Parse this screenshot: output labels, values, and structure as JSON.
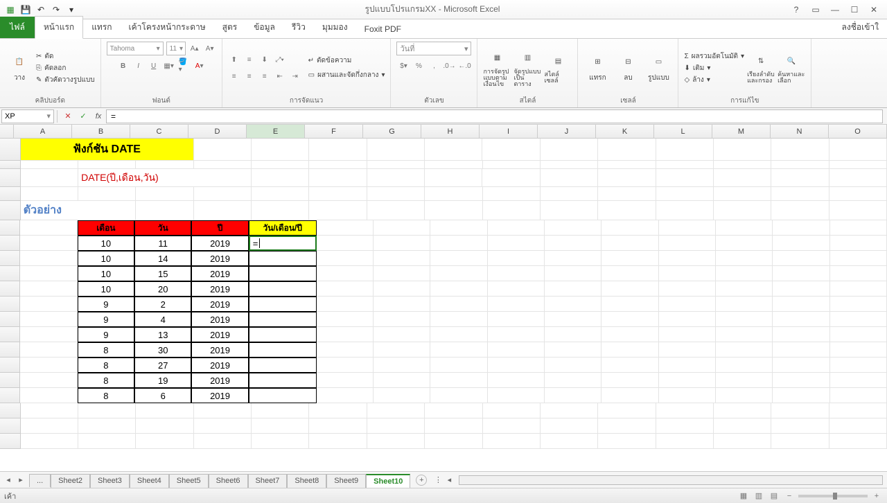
{
  "titlebar": {
    "title": "รูปแบบโปรแกรมXX - Microsoft Excel"
  },
  "tabs": {
    "file": "ไฟล์",
    "items": [
      "หน้าแรก",
      "แทรก",
      "เค้าโครงหน้ากระดาษ",
      "สูตร",
      "ข้อมูล",
      "รีวิว",
      "มุมมอง",
      "Foxit PDF"
    ],
    "active": 0,
    "signin": "ลงชื่อเข้าใ"
  },
  "ribbon": {
    "clipboard": {
      "label": "คลิปบอร์ด",
      "paste": "วาง",
      "cut": "ตัด",
      "copy": "คัดลอก",
      "fmtpainter": "ตัวคัดวางรูปแบบ"
    },
    "font": {
      "label": "ฟอนต์",
      "name": "Tahoma",
      "size": "11"
    },
    "alignment": {
      "label": "การจัดแนว",
      "wrap": "ตัดข้อความ",
      "merge": "ผสานและจัดกึ่งกลาง"
    },
    "number": {
      "label": "ตัวเลข",
      "format": "วันที่"
    },
    "styles": {
      "label": "สไตล์",
      "condfmt": "การจัดรูปแบบตามเงื่อนไข",
      "tblfmt": "จัดรูปแบบเป็นตาราง",
      "cellstyle": "สไตล์เซลล์"
    },
    "cells": {
      "label": "เซลล์",
      "insert": "แทรก",
      "delete": "ลบ",
      "format": "รูปแบบ"
    },
    "editing": {
      "label": "การแก้ไข",
      "autosum": "ผลรวมอัตโนมัติ",
      "fill": "เติม",
      "clear": "ล้าง",
      "sort": "เรียงลำดับและกรอง",
      "find": "ค้นหาและเลือก"
    }
  },
  "formulabar": {
    "namebox": "XP",
    "formula": "="
  },
  "columns": [
    "A",
    "B",
    "C",
    "D",
    "E",
    "F",
    "G",
    "H",
    "I",
    "J",
    "K",
    "L",
    "M",
    "N",
    "O"
  ],
  "activeCol": 4,
  "content": {
    "title": "ฟังก์ชัน DATE",
    "syntax": "DATE(ปี,เดือน,วัน)",
    "example": "ตัวอย่าง",
    "headers": {
      "month": "เดือน",
      "day": "วัน",
      "year": "ปี",
      "dmy": "วัน/เดือน/ปี"
    },
    "rows": [
      {
        "m": "10",
        "d": "11",
        "y": "2019"
      },
      {
        "m": "10",
        "d": "14",
        "y": "2019"
      },
      {
        "m": "10",
        "d": "15",
        "y": "2019"
      },
      {
        "m": "10",
        "d": "20",
        "y": "2019"
      },
      {
        "m": "9",
        "d": "2",
        "y": "2019"
      },
      {
        "m": "9",
        "d": "4",
        "y": "2019"
      },
      {
        "m": "9",
        "d": "13",
        "y": "2019"
      },
      {
        "m": "8",
        "d": "30",
        "y": "2019"
      },
      {
        "m": "8",
        "d": "27",
        "y": "2019"
      },
      {
        "m": "8",
        "d": "19",
        "y": "2019"
      },
      {
        "m": "8",
        "d": "6",
        "y": "2019"
      }
    ],
    "editing": "="
  },
  "sheets": {
    "ellipsis": "...",
    "items": [
      "Sheet2",
      "Sheet3",
      "Sheet4",
      "Sheet5",
      "Sheet6",
      "Sheet7",
      "Sheet8",
      "Sheet9",
      "Sheet10"
    ],
    "active": 8
  },
  "statusbar": {
    "mode": "เค้า"
  }
}
